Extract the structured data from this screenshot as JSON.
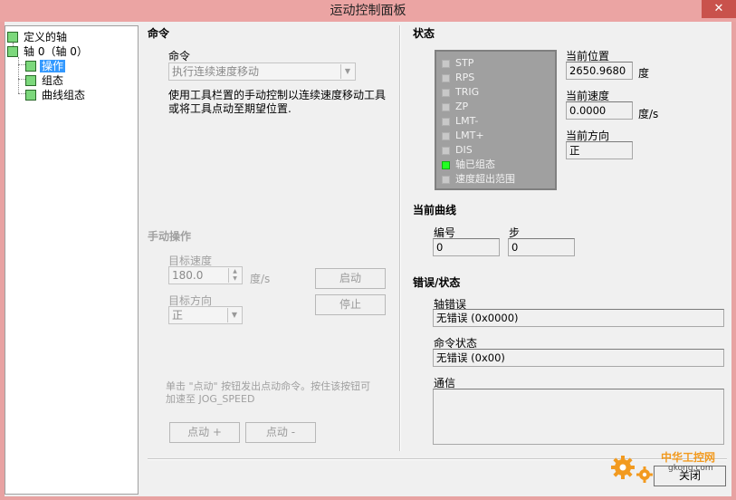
{
  "window": {
    "title": "运动控制面板",
    "close": "✕"
  },
  "tree": {
    "root1": "定义的轴",
    "root2": "轴 0（轴 0）",
    "child1": "操作",
    "child2": "组态",
    "child3": "曲线组态"
  },
  "command": {
    "section_title": "命令",
    "label": "命令",
    "selected": "执行连续速度移动",
    "desc_line1": "使用工具栏置的手动控制以连续速度移动工具",
    "desc_line2": "或将工具点动至期望位置."
  },
  "manual": {
    "section_title": "手动操作",
    "target_speed_label": "目标速度",
    "target_speed_value": "180.0",
    "speed_unit": "度/s",
    "target_dir_label": "目标方向",
    "target_dir_value": "正",
    "start_button": "启动",
    "stop_button": "停止",
    "hint_line1": "单击 \"点动\" 按钮发出点动命令。按住该按钮可",
    "hint_line2": "加速至 JOG_SPEED",
    "jog_plus": "点动 +",
    "jog_minus": "点动 -"
  },
  "status": {
    "section_title": "状态",
    "flags": [
      {
        "label": "STP",
        "on": false
      },
      {
        "label": "RPS",
        "on": false
      },
      {
        "label": "TRIG",
        "on": false
      },
      {
        "label": "ZP",
        "on": false
      },
      {
        "label": "LMT-",
        "on": false
      },
      {
        "label": "LMT+",
        "on": false
      },
      {
        "label": "DIS",
        "on": false
      },
      {
        "label": "轴已组态",
        "on": true
      },
      {
        "label": "速度超出范围",
        "on": false
      }
    ],
    "led_on_color": "#22ff22",
    "led_off_color": "#c8c8c8",
    "cur_pos_label": "当前位置",
    "cur_pos_value": "2650.9680",
    "pos_unit": "度",
    "cur_speed_label": "当前速度",
    "cur_speed_value": "0.0000",
    "speed_unit": "度/s",
    "cur_dir_label": "当前方向",
    "cur_dir_value": "正"
  },
  "curve": {
    "section_title": "当前曲线",
    "number_label": "编号",
    "number_value": "0",
    "step_label": "步",
    "step_value": "0"
  },
  "errors": {
    "section_title": "错误/状态",
    "axis_error_label": "轴错误",
    "axis_error_value": "无错误 (0x0000)",
    "cmd_status_label": "命令状态",
    "cmd_status_value": "无错误 (0x00)",
    "comm_label": "通信",
    "comm_value": ""
  },
  "footer": {
    "close_button": "关闭"
  },
  "watermark": {
    "text": "中华工控网",
    "domain": "gkong.com"
  }
}
